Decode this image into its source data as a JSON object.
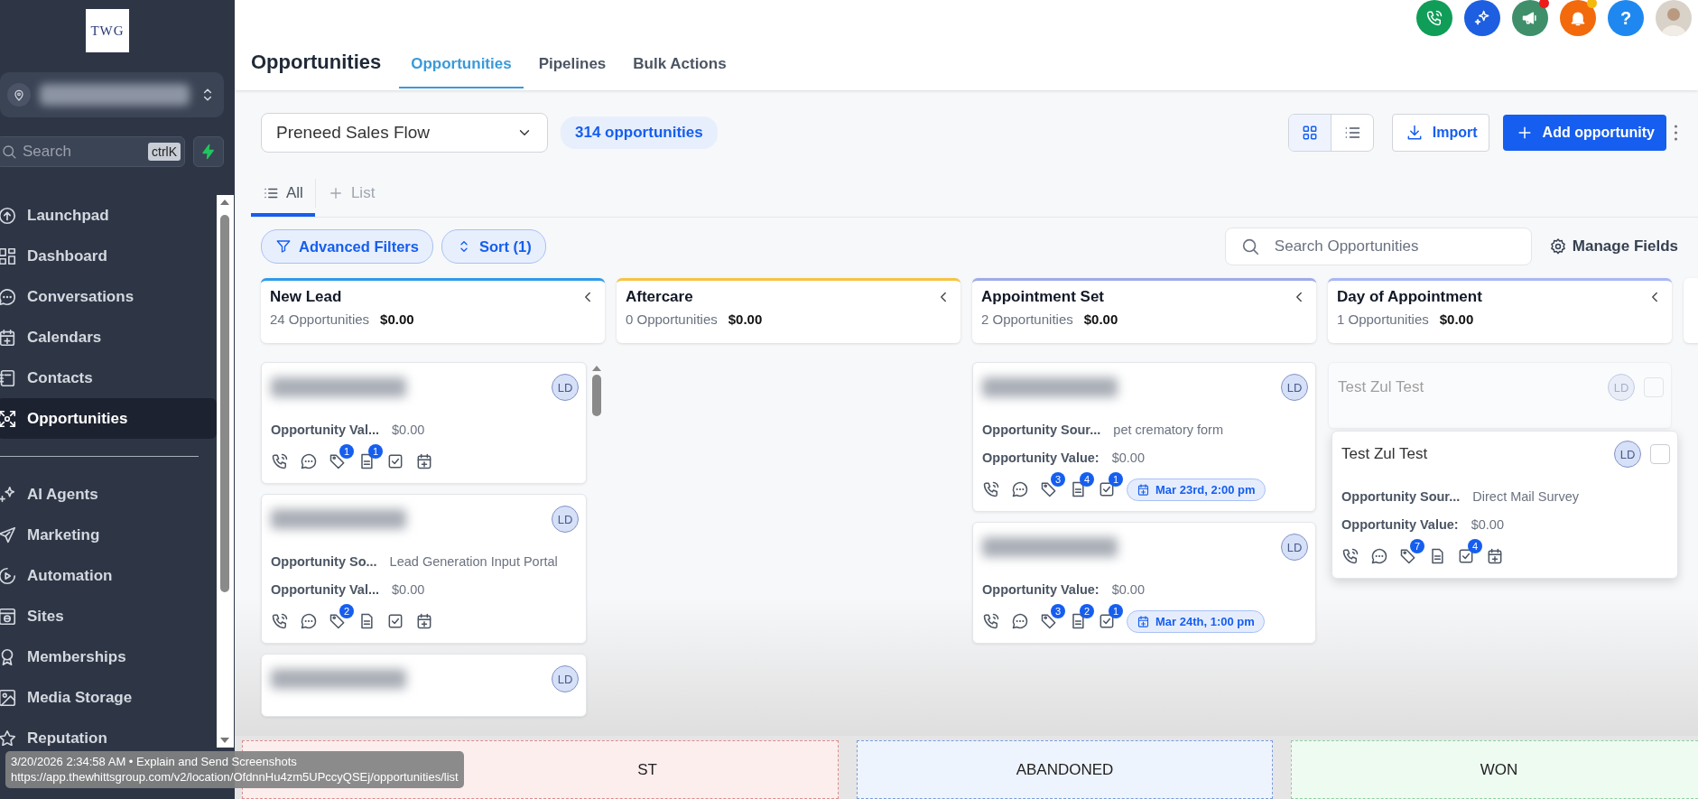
{
  "sidebar": {
    "logo": "TWG",
    "location": {
      "blurred": true
    },
    "search": {
      "placeholder": "Search",
      "shortcut": "ctrlK"
    },
    "nav_main": [
      {
        "label": "Launchpad",
        "selected": false
      },
      {
        "label": "Dashboard",
        "selected": false
      },
      {
        "label": "Conversations",
        "selected": false
      },
      {
        "label": "Calendars",
        "selected": false
      },
      {
        "label": "Contacts",
        "selected": false
      },
      {
        "label": "Opportunities",
        "selected": true
      }
    ],
    "nav_tools": [
      {
        "label": "AI Agents",
        "selected": false
      },
      {
        "label": "Marketing",
        "selected": false
      },
      {
        "label": "Automation",
        "selected": false
      },
      {
        "label": "Sites",
        "selected": false
      },
      {
        "label": "Memberships",
        "selected": false
      },
      {
        "label": "Media Storage",
        "selected": false
      },
      {
        "label": "Reputation",
        "selected": false
      }
    ]
  },
  "topbar": {
    "buttons": [
      {
        "kind": "phone",
        "color": "#0f9d58"
      },
      {
        "kind": "sparkle",
        "color": "#1d5fe0"
      },
      {
        "kind": "megaphone",
        "color": "#3f8f6b",
        "dot": {
          "color": "#ef1c1c"
        }
      },
      {
        "kind": "bell",
        "color": "#f26a0c",
        "dot": {
          "color": "#f5b90b"
        }
      },
      {
        "kind": "help",
        "color": "#1e88f0",
        "label": "?"
      },
      {
        "kind": "avatar",
        "color": "#d9d2c8"
      }
    ]
  },
  "page": {
    "title": "Opportunities",
    "tabs": [
      {
        "label": "Opportunities",
        "selected": true
      },
      {
        "label": "Pipelines",
        "selected": false
      },
      {
        "label": "Bulk Actions",
        "selected": false
      }
    ]
  },
  "toolbar": {
    "pipeline": "Preneed Sales Flow",
    "count": "314 opportunities",
    "view_modes": [
      {
        "kind": "grid",
        "selected": true
      },
      {
        "kind": "list",
        "selected": false
      }
    ],
    "import": "Import",
    "add": "Add opportunity"
  },
  "views": [
    {
      "label": "All",
      "selected": true
    },
    {
      "label": "List",
      "selected": false
    }
  ],
  "filters": [
    {
      "label": "Advanced Filters"
    },
    {
      "label": "Sort (1)"
    }
  ],
  "search": {
    "placeholder": "Search Opportunities"
  },
  "manage_fields": "Manage Fields",
  "columns": [
    {
      "name": "New Lead",
      "count": "24 Opportunities",
      "total": "$0.00",
      "color": "#2f9be8",
      "scrollbar": true,
      "cards": [
        {
          "kind": "normal",
          "blurred": true,
          "avatar": "LD",
          "fields": [
            {
              "label": "Opportunity Val...",
              "value": "$0.00"
            }
          ],
          "actions": [
            {
              "kind": "phone"
            },
            {
              "kind": "chat"
            },
            {
              "kind": "tag",
              "count": "1"
            },
            {
              "kind": "note",
              "count": "1"
            },
            {
              "kind": "task"
            },
            {
              "kind": "calendar"
            }
          ]
        },
        {
          "kind": "normal",
          "blurred": true,
          "avatar": "LD",
          "fields": [
            {
              "label": "Opportunity So...",
              "value": "Lead Generation Input Portal"
            },
            {
              "label": "Opportunity Val...",
              "value": "$0.00"
            }
          ],
          "actions": [
            {
              "kind": "phone"
            },
            {
              "kind": "chat"
            },
            {
              "kind": "tag",
              "count": "2"
            },
            {
              "kind": "note"
            },
            {
              "kind": "task"
            },
            {
              "kind": "calendar"
            }
          ]
        },
        {
          "kind": "normal",
          "blurred": true,
          "avatar": "LD"
        }
      ]
    },
    {
      "name": "Aftercare",
      "count": "0 Opportunities",
      "total": "$0.00",
      "color": "#f6c443"
    },
    {
      "name": "Appointment Set",
      "count": "2 Opportunities",
      "total": "$0.00",
      "color": "#9fabe9",
      "cards": [
        {
          "kind": "normal",
          "blurred": true,
          "avatar": "LD",
          "fields": [
            {
              "label": "Opportunity Sour...",
              "value": "pet crematory form"
            },
            {
              "label": "Opportunity Value:",
              "value": "$0.00"
            }
          ],
          "actions": [
            {
              "kind": "phone"
            },
            {
              "kind": "chat"
            },
            {
              "kind": "tag",
              "count": "3"
            },
            {
              "kind": "note",
              "count": "4"
            },
            {
              "kind": "task",
              "count": "1"
            }
          ],
          "appointment": "Mar 23rd, 2:00 pm"
        },
        {
          "kind": "normal",
          "blurred": true,
          "avatar": "LD",
          "fields": [
            {
              "label": "Opportunity Value:",
              "value": "$0.00"
            }
          ],
          "actions": [
            {
              "kind": "phone"
            },
            {
              "kind": "chat"
            },
            {
              "kind": "tag",
              "count": "3"
            },
            {
              "kind": "note",
              "count": "2"
            },
            {
              "kind": "task",
              "count": "1"
            }
          ],
          "appointment": "Mar 24th, 1:00 pm"
        }
      ]
    },
    {
      "name": "Day of Appointment",
      "count": "1 Opportunities",
      "total": "$0.00",
      "color": "#a9b7f5",
      "cards": [
        {
          "kind": "ghost",
          "title": "Test Zul Test",
          "avatar": "LD",
          "checked": false
        },
        {
          "kind": "dragging",
          "title": "Test Zul Test",
          "avatar": "LD",
          "checked": false,
          "fields": [
            {
              "label": "Opportunity Sour...",
              "value": "Direct Mail Survey"
            },
            {
              "label": "Opportunity Value:",
              "value": "$0.00"
            }
          ],
          "actions": [
            {
              "kind": "phone"
            },
            {
              "kind": "chat"
            },
            {
              "kind": "tag",
              "count": "7"
            },
            {
              "kind": "note"
            },
            {
              "kind": "task",
              "count": "4"
            },
            {
              "kind": "calendar"
            }
          ]
        }
      ]
    }
  ],
  "drop_zones": [
    {
      "label": "ST",
      "color": "#fdeeee"
    },
    {
      "label": "ABANDONED",
      "color": "#eef4fd"
    },
    {
      "label": "WON",
      "color": "#eefbf1"
    }
  ],
  "capture_tip": {
    "line1": "3/20/2026 2:34:58 AM • Explain and Send Screenshots",
    "line2": "https://app.thewhittsgroup.com/v2/location/OfdnnHu4zm5UPccyQSEj/opportunities/list"
  }
}
